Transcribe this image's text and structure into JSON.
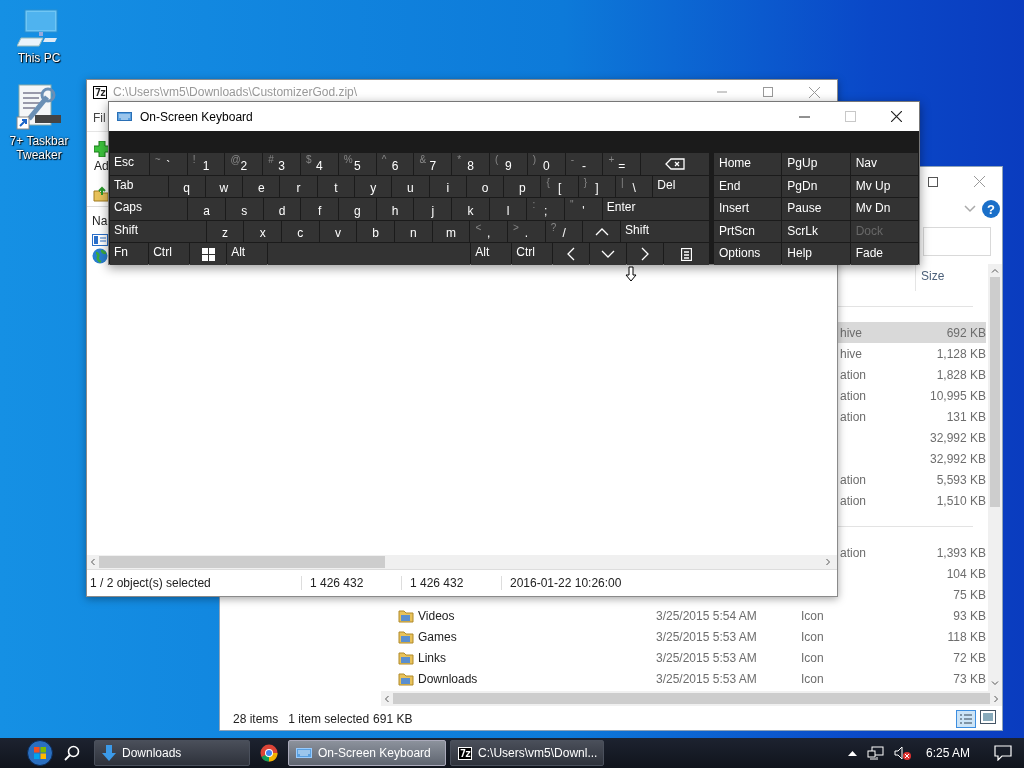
{
  "desktop_icons": [
    {
      "label": "This PC",
      "kind": "computer"
    },
    {
      "label": "7+ Taskbar Tweaker",
      "kind": "tweaker"
    }
  ],
  "explorer": {
    "columns": [
      {
        "label": "Size"
      }
    ],
    "help_glyph": "?",
    "groups": [
      {
        "rows": [
          {
            "type": "hive",
            "size": "692 KB",
            "selected": true
          },
          {
            "type": "hive",
            "size": "1,128 KB",
            "selected": false
          },
          {
            "type": "ation",
            "size": "1,828 KB",
            "selected": false
          },
          {
            "type": "ation",
            "size": "10,995 KB",
            "selected": false
          },
          {
            "type": "ation",
            "size": "131 KB",
            "selected": false
          },
          {
            "size": "32,992 KB",
            "selected": false
          },
          {
            "size": "32,992 KB",
            "selected": false
          },
          {
            "type": "ation",
            "size": "5,593 KB",
            "selected": false
          },
          {
            "type": "ation",
            "size": "1,510 KB",
            "selected": false
          }
        ]
      },
      {
        "rows": [
          {
            "type": "ation",
            "size": "1,393 KB",
            "selected": false
          },
          {
            "size": "104 KB",
            "selected": false
          },
          {
            "size": "75 KB",
            "selected": false
          },
          {
            "name": "Videos",
            "date": "3/25/2015 5:54 AM",
            "type": "Icon",
            "size": "93 KB",
            "selected": false
          },
          {
            "name": "Games",
            "date": "3/25/2015 5:53 AM",
            "type": "Icon",
            "size": "118 KB",
            "selected": false
          },
          {
            "name": "Links",
            "date": "3/25/2015 5:53 AM",
            "type": "Icon",
            "size": "72 KB",
            "selected": false
          },
          {
            "name": "Downloads",
            "date": "3/25/2015 5:53 AM",
            "type": "Icon",
            "size": "73 KB",
            "selected": false
          }
        ]
      }
    ],
    "status": [
      "28 items",
      "1 item selected",
      "691 KB"
    ]
  },
  "sevenzip": {
    "logo_text": "7z",
    "title": "C:\\Users\\vm5\\Downloads\\CustomizerGod.zip\\",
    "menu": "Fil",
    "toolbar_label": "Ad",
    "column": "Na",
    "status": [
      "1 / 2 object(s) selected",
      "1 426 432",
      "1 426 432",
      "2016-01-22 10:26:00"
    ]
  },
  "keyboard": {
    "title": "On-Screen Keyboard",
    "controls": [
      {
        "kind": "minimize",
        "disabled": false
      },
      {
        "kind": "maximize",
        "disabled": true
      },
      {
        "kind": "close",
        "disabled": false
      }
    ],
    "rows": [
      [
        {
          "kind": "text",
          "label": "Esc"
        },
        {
          "kind": "char",
          "shift": "~",
          "label": "`"
        },
        {
          "kind": "char",
          "shift": "!",
          "label": "1"
        },
        {
          "kind": "char",
          "shift": "@",
          "label": "2"
        },
        {
          "kind": "char",
          "shift": "#",
          "label": "3"
        },
        {
          "kind": "char",
          "shift": "$",
          "label": "4"
        },
        {
          "kind": "char",
          "shift": "%",
          "label": "5"
        },
        {
          "kind": "char",
          "shift": "^",
          "label": "6"
        },
        {
          "kind": "char",
          "shift": "&",
          "label": "7"
        },
        {
          "kind": "char",
          "shift": "*",
          "label": "8"
        },
        {
          "kind": "char",
          "shift": "(",
          "label": "9"
        },
        {
          "kind": "char",
          "shift": ")",
          "label": "0"
        },
        {
          "kind": "char",
          "shift": "-",
          "label": "-"
        },
        {
          "kind": "char",
          "shift": "+",
          "label": "="
        },
        {
          "kind": "backspace"
        }
      ],
      [
        {
          "kind": "text",
          "label": "Tab"
        },
        {
          "kind": "char",
          "label": "q"
        },
        {
          "kind": "char",
          "label": "w"
        },
        {
          "kind": "char",
          "label": "e"
        },
        {
          "kind": "char",
          "label": "r"
        },
        {
          "kind": "char",
          "label": "t"
        },
        {
          "kind": "char",
          "label": "y"
        },
        {
          "kind": "char",
          "label": "u"
        },
        {
          "kind": "char",
          "label": "i"
        },
        {
          "kind": "char",
          "label": "o"
        },
        {
          "kind": "char",
          "label": "p"
        },
        {
          "kind": "char",
          "shift": "{",
          "label": "["
        },
        {
          "kind": "char",
          "shift": "}",
          "label": "]"
        },
        {
          "kind": "char",
          "shift": "|",
          "label": "\\"
        },
        {
          "kind": "text",
          "label": "Del"
        }
      ],
      [
        {
          "kind": "text",
          "label": "Caps"
        },
        {
          "kind": "char",
          "label": "a"
        },
        {
          "kind": "char",
          "label": "s"
        },
        {
          "kind": "char",
          "label": "d"
        },
        {
          "kind": "char",
          "label": "f"
        },
        {
          "kind": "char",
          "label": "g"
        },
        {
          "kind": "char",
          "label": "h"
        },
        {
          "kind": "char",
          "label": "j"
        },
        {
          "kind": "char",
          "label": "k"
        },
        {
          "kind": "char",
          "label": "l"
        },
        {
          "kind": "char",
          "shift": ":",
          "label": ";"
        },
        {
          "kind": "char",
          "shift": "\"",
          "label": "'"
        },
        {
          "kind": "text",
          "label": "Enter"
        }
      ],
      [
        {
          "kind": "text",
          "label": "Shift"
        },
        {
          "kind": "char",
          "label": "z"
        },
        {
          "kind": "char",
          "label": "x"
        },
        {
          "kind": "char",
          "label": "c"
        },
        {
          "kind": "char",
          "label": "v"
        },
        {
          "kind": "char",
          "label": "b"
        },
        {
          "kind": "char",
          "label": "n"
        },
        {
          "kind": "char",
          "label": "m"
        },
        {
          "kind": "char",
          "shift": "<",
          "label": ","
        },
        {
          "kind": "char",
          "shift": ">",
          "label": "."
        },
        {
          "kind": "char",
          "shift": "?",
          "label": "/"
        },
        {
          "kind": "up"
        },
        {
          "kind": "text",
          "label": "Shift"
        }
      ],
      [
        {
          "kind": "text",
          "label": "Fn"
        },
        {
          "kind": "text",
          "label": "Ctrl"
        },
        {
          "kind": "windows"
        },
        {
          "kind": "text",
          "label": "Alt"
        },
        {
          "kind": "space"
        },
        {
          "kind": "text",
          "label": "Alt"
        },
        {
          "kind": "text",
          "label": "Ctrl"
        },
        {
          "kind": "left"
        },
        {
          "kind": "down"
        },
        {
          "kind": "right"
        },
        {
          "kind": "menu"
        }
      ]
    ],
    "nav_keys": [
      [
        {
          "label": "Home",
          "disabled": false
        },
        {
          "label": "PgUp",
          "disabled": false
        },
        {
          "label": "Nav",
          "disabled": false
        }
      ],
      [
        {
          "label": "End",
          "disabled": false
        },
        {
          "label": "PgDn",
          "disabled": false
        },
        {
          "label": "Mv Up",
          "disabled": false
        }
      ],
      [
        {
          "label": "Insert",
          "disabled": false
        },
        {
          "label": "Pause",
          "disabled": false
        },
        {
          "label": "Mv Dn",
          "disabled": false
        }
      ],
      [
        {
          "label": "PrtScn",
          "disabled": false
        },
        {
          "label": "ScrLk",
          "disabled": false
        },
        {
          "label": "Dock",
          "disabled": true
        }
      ],
      [
        {
          "label": "Options",
          "disabled": false
        },
        {
          "label": "Help",
          "disabled": false
        },
        {
          "label": "Fade",
          "disabled": false
        }
      ]
    ]
  },
  "taskbar": {
    "buttons": [
      {
        "kind": "explorer",
        "label": "Downloads",
        "selected": false
      },
      {
        "kind": "browser",
        "selected": false
      },
      {
        "kind": "keyboard",
        "label": "On-Screen Keyboard",
        "selected": true
      },
      {
        "kind": "sevenzip",
        "logo_text": "7z",
        "label": "C:\\Users\\vm5\\Downl...",
        "selected": false
      }
    ],
    "clock": "6:25 AM"
  }
}
